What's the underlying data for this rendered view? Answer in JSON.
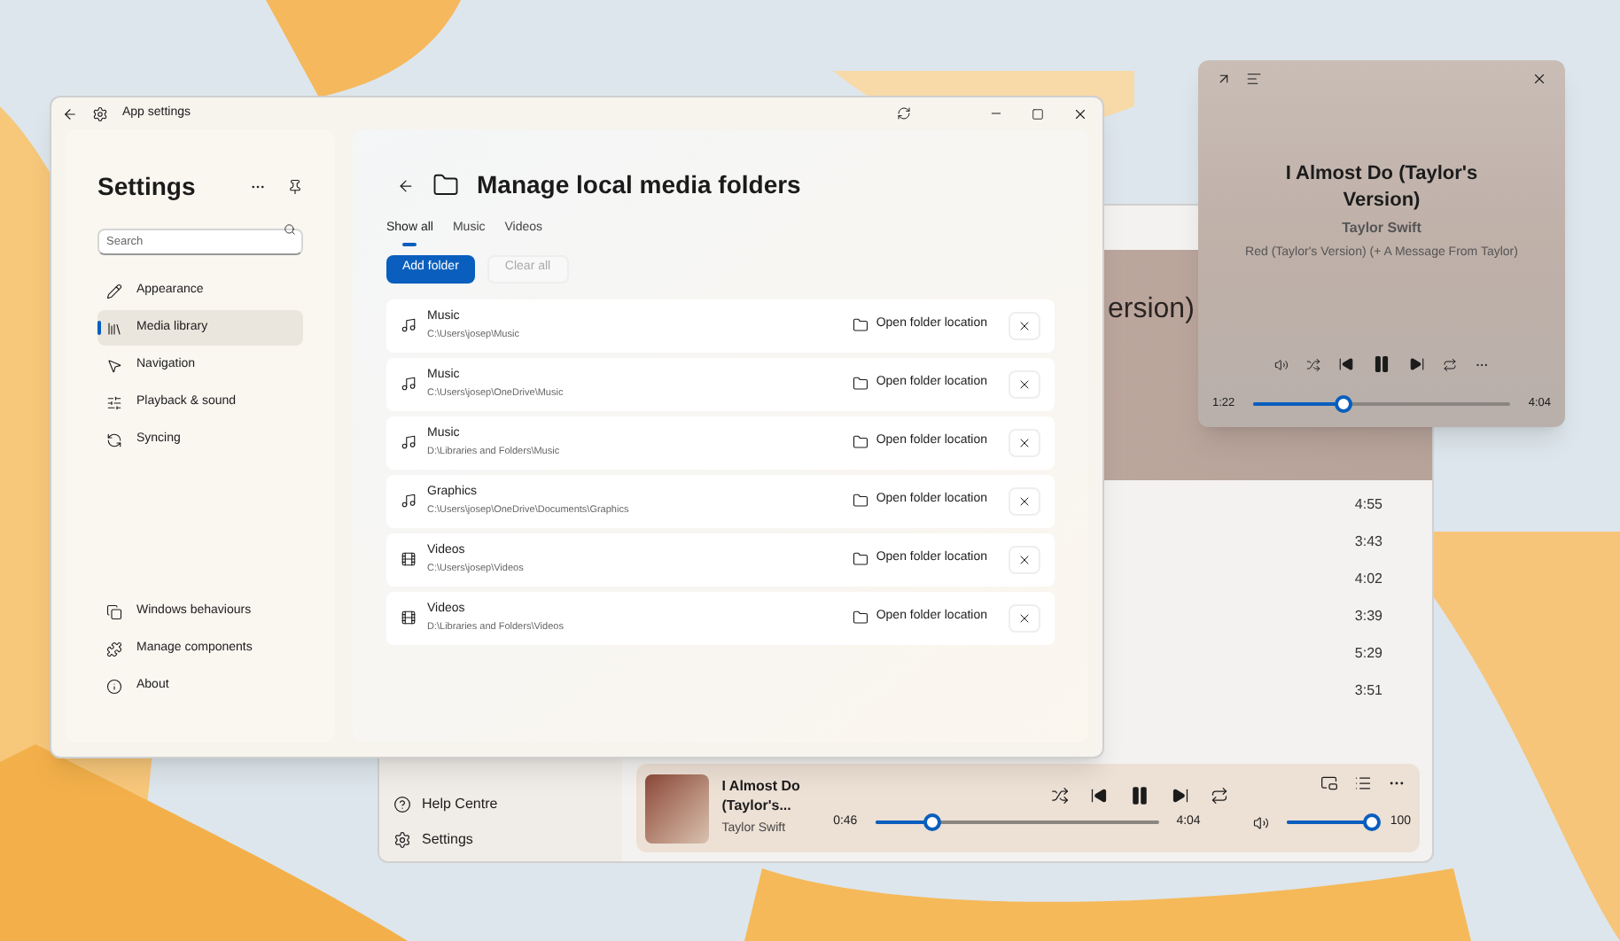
{
  "settings_window": {
    "title": "App settings",
    "sidebar": {
      "title": "Settings",
      "search": {
        "placeholder": "Search"
      },
      "items": [
        {
          "label": "Appearance",
          "selected": false
        },
        {
          "label": "Media library",
          "selected": true
        },
        {
          "label": "Navigation",
          "selected": false
        },
        {
          "label": "Playback & sound",
          "selected": false
        },
        {
          "label": "Syncing",
          "selected": false
        }
      ],
      "footer_items": [
        {
          "label": "Windows behaviours"
        },
        {
          "label": "Manage components"
        },
        {
          "label": "About"
        }
      ]
    },
    "page": {
      "title": "Manage local media folders",
      "tabs": [
        {
          "label": "Show all",
          "selected": true
        },
        {
          "label": "Music",
          "selected": false
        },
        {
          "label": "Videos",
          "selected": false
        }
      ],
      "buttons": [
        {
          "label": "Add folder",
          "disabled": false
        },
        {
          "label": "Clear all",
          "disabled": true
        }
      ],
      "folders": [
        {
          "kind": "music",
          "name": "Music",
          "path": "C:\\Users\\josep\\Music",
          "action": "Open folder location"
        },
        {
          "kind": "music",
          "name": "Music",
          "path": "C:\\Users\\josep\\OneDrive\\Music",
          "action": "Open folder location"
        },
        {
          "kind": "music",
          "name": "Music",
          "path": "D:\\Libraries and Folders\\Music",
          "action": "Open folder location"
        },
        {
          "kind": "music",
          "name": "Graphics",
          "path": "C:\\Users\\josep\\OneDrive\\Documents\\Graphics",
          "action": "Open folder location"
        },
        {
          "kind": "video",
          "name": "Videos",
          "path": "C:\\Users\\josep\\Videos",
          "action": "Open folder location"
        },
        {
          "kind": "video",
          "name": "Videos",
          "path": "D:\\Libraries and Folders\\Videos",
          "action": "Open folder location"
        }
      ]
    }
  },
  "player_window": {
    "header_title": "ersion)",
    "durations": [
      "4:55",
      "3:43",
      "4:02",
      "3:39",
      "5:29",
      "3:51"
    ],
    "sidebar_items": [
      {
        "label": "Help Centre"
      },
      {
        "label": "Settings"
      }
    ],
    "now_playing": {
      "title": "I Almost Do (Taylor's...",
      "artist": "Taylor Swift",
      "elapsed": "0:46",
      "total": "4:04",
      "level": 0.2,
      "volume": {
        "level": 1.0,
        "reading": "100"
      }
    }
  },
  "mini_player": {
    "title": "I Almost Do (Taylor's Version)",
    "artist": "Taylor Swift",
    "album": "Red (Taylor's Version) (+ A Message From Taylor)",
    "elapsed": "1:22",
    "total": "4:04",
    "level": 0.35
  }
}
